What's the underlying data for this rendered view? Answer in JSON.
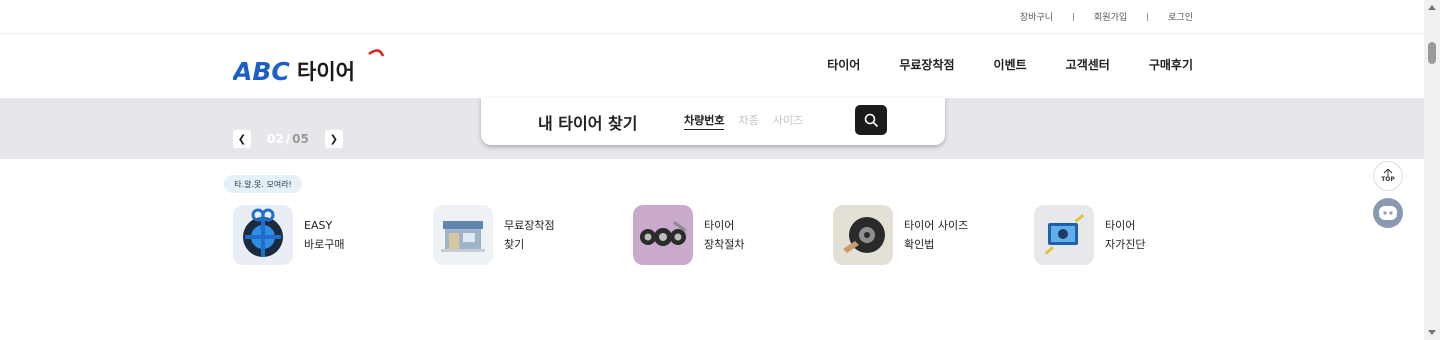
{
  "util_links": [
    "장바구니",
    "회원가입",
    "로그인"
  ],
  "logo": {
    "latin": "ABC",
    "hangul": "타이어",
    "brand_color": "#1d5fc8",
    "accent_color": "#e02020"
  },
  "gnb": [
    "타이어",
    "무료장착점",
    "이벤트",
    "고객센터",
    "구매후기"
  ],
  "pager": {
    "current": "02",
    "separator": "/",
    "total": "05",
    "prev_icon": "chevron-left-icon",
    "next_icon": "chevron-right-icon"
  },
  "search": {
    "title": "내 타이어 찾기",
    "tabs": [
      "차량번호",
      "차종",
      "사이즈"
    ],
    "active_tab": "차량번호",
    "button_icon": "search-icon"
  },
  "tag_pill": "타.알.못. 모여라!",
  "quick_menu": [
    {
      "line1": "EASY",
      "line2": "바로구매",
      "icon": "tire-gift-icon"
    },
    {
      "line1": "무료장착점",
      "line2": "찾기",
      "icon": "shop-icon"
    },
    {
      "line1": "타이어",
      "line2": "장착절차",
      "icon": "tire-mounting-icon"
    },
    {
      "line1": "타이어 사이즈",
      "line2": "확인법",
      "icon": "tire-size-icon"
    },
    {
      "line1": "타이어",
      "line2": "자가진단",
      "icon": "self-diagnosis-icon"
    }
  ],
  "floating": {
    "top_label": "TOP",
    "chat_icon": "chatbot-icon"
  },
  "colors": {
    "band": "#e6e7ea",
    "search_button": "#1b1b1b",
    "pill_bg": "#e4f1fb",
    "chat_bg": "#8c9ab0"
  }
}
